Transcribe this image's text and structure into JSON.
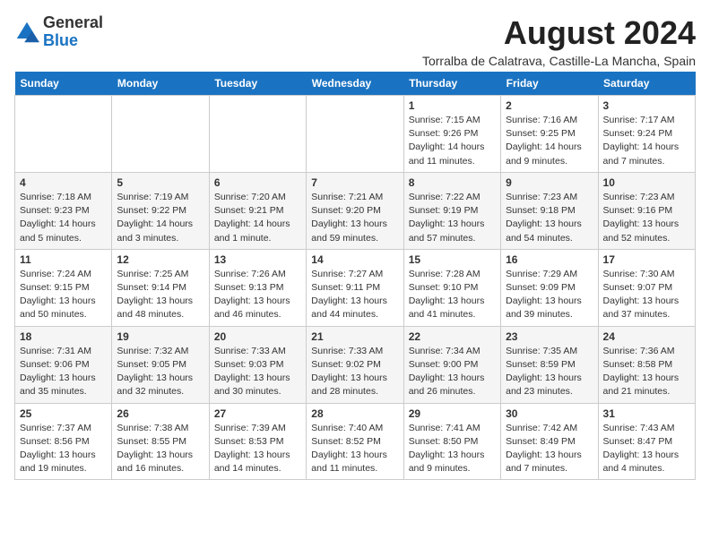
{
  "header": {
    "logo_general": "General",
    "logo_blue": "Blue",
    "title": "August 2024",
    "location": "Torralba de Calatrava, Castille-La Mancha, Spain"
  },
  "days_of_week": [
    "Sunday",
    "Monday",
    "Tuesday",
    "Wednesday",
    "Thursday",
    "Friday",
    "Saturday"
  ],
  "weeks": [
    [
      {
        "day": "",
        "info": ""
      },
      {
        "day": "",
        "info": ""
      },
      {
        "day": "",
        "info": ""
      },
      {
        "day": "",
        "info": ""
      },
      {
        "day": "1",
        "info": "Sunrise: 7:15 AM\nSunset: 9:26 PM\nDaylight: 14 hours\nand 11 minutes."
      },
      {
        "day": "2",
        "info": "Sunrise: 7:16 AM\nSunset: 9:25 PM\nDaylight: 14 hours\nand 9 minutes."
      },
      {
        "day": "3",
        "info": "Sunrise: 7:17 AM\nSunset: 9:24 PM\nDaylight: 14 hours\nand 7 minutes."
      }
    ],
    [
      {
        "day": "4",
        "info": "Sunrise: 7:18 AM\nSunset: 9:23 PM\nDaylight: 14 hours\nand 5 minutes."
      },
      {
        "day": "5",
        "info": "Sunrise: 7:19 AM\nSunset: 9:22 PM\nDaylight: 14 hours\nand 3 minutes."
      },
      {
        "day": "6",
        "info": "Sunrise: 7:20 AM\nSunset: 9:21 PM\nDaylight: 14 hours\nand 1 minute."
      },
      {
        "day": "7",
        "info": "Sunrise: 7:21 AM\nSunset: 9:20 PM\nDaylight: 13 hours\nand 59 minutes."
      },
      {
        "day": "8",
        "info": "Sunrise: 7:22 AM\nSunset: 9:19 PM\nDaylight: 13 hours\nand 57 minutes."
      },
      {
        "day": "9",
        "info": "Sunrise: 7:23 AM\nSunset: 9:18 PM\nDaylight: 13 hours\nand 54 minutes."
      },
      {
        "day": "10",
        "info": "Sunrise: 7:23 AM\nSunset: 9:16 PM\nDaylight: 13 hours\nand 52 minutes."
      }
    ],
    [
      {
        "day": "11",
        "info": "Sunrise: 7:24 AM\nSunset: 9:15 PM\nDaylight: 13 hours\nand 50 minutes."
      },
      {
        "day": "12",
        "info": "Sunrise: 7:25 AM\nSunset: 9:14 PM\nDaylight: 13 hours\nand 48 minutes."
      },
      {
        "day": "13",
        "info": "Sunrise: 7:26 AM\nSunset: 9:13 PM\nDaylight: 13 hours\nand 46 minutes."
      },
      {
        "day": "14",
        "info": "Sunrise: 7:27 AM\nSunset: 9:11 PM\nDaylight: 13 hours\nand 44 minutes."
      },
      {
        "day": "15",
        "info": "Sunrise: 7:28 AM\nSunset: 9:10 PM\nDaylight: 13 hours\nand 41 minutes."
      },
      {
        "day": "16",
        "info": "Sunrise: 7:29 AM\nSunset: 9:09 PM\nDaylight: 13 hours\nand 39 minutes."
      },
      {
        "day": "17",
        "info": "Sunrise: 7:30 AM\nSunset: 9:07 PM\nDaylight: 13 hours\nand 37 minutes."
      }
    ],
    [
      {
        "day": "18",
        "info": "Sunrise: 7:31 AM\nSunset: 9:06 PM\nDaylight: 13 hours\nand 35 minutes."
      },
      {
        "day": "19",
        "info": "Sunrise: 7:32 AM\nSunset: 9:05 PM\nDaylight: 13 hours\nand 32 minutes."
      },
      {
        "day": "20",
        "info": "Sunrise: 7:33 AM\nSunset: 9:03 PM\nDaylight: 13 hours\nand 30 minutes."
      },
      {
        "day": "21",
        "info": "Sunrise: 7:33 AM\nSunset: 9:02 PM\nDaylight: 13 hours\nand 28 minutes."
      },
      {
        "day": "22",
        "info": "Sunrise: 7:34 AM\nSunset: 9:00 PM\nDaylight: 13 hours\nand 26 minutes."
      },
      {
        "day": "23",
        "info": "Sunrise: 7:35 AM\nSunset: 8:59 PM\nDaylight: 13 hours\nand 23 minutes."
      },
      {
        "day": "24",
        "info": "Sunrise: 7:36 AM\nSunset: 8:58 PM\nDaylight: 13 hours\nand 21 minutes."
      }
    ],
    [
      {
        "day": "25",
        "info": "Sunrise: 7:37 AM\nSunset: 8:56 PM\nDaylight: 13 hours\nand 19 minutes."
      },
      {
        "day": "26",
        "info": "Sunrise: 7:38 AM\nSunset: 8:55 PM\nDaylight: 13 hours\nand 16 minutes."
      },
      {
        "day": "27",
        "info": "Sunrise: 7:39 AM\nSunset: 8:53 PM\nDaylight: 13 hours\nand 14 minutes."
      },
      {
        "day": "28",
        "info": "Sunrise: 7:40 AM\nSunset: 8:52 PM\nDaylight: 13 hours\nand 11 minutes."
      },
      {
        "day": "29",
        "info": "Sunrise: 7:41 AM\nSunset: 8:50 PM\nDaylight: 13 hours\nand 9 minutes."
      },
      {
        "day": "30",
        "info": "Sunrise: 7:42 AM\nSunset: 8:49 PM\nDaylight: 13 hours\nand 7 minutes."
      },
      {
        "day": "31",
        "info": "Sunrise: 7:43 AM\nSunset: 8:47 PM\nDaylight: 13 hours\nand 4 minutes."
      }
    ]
  ]
}
